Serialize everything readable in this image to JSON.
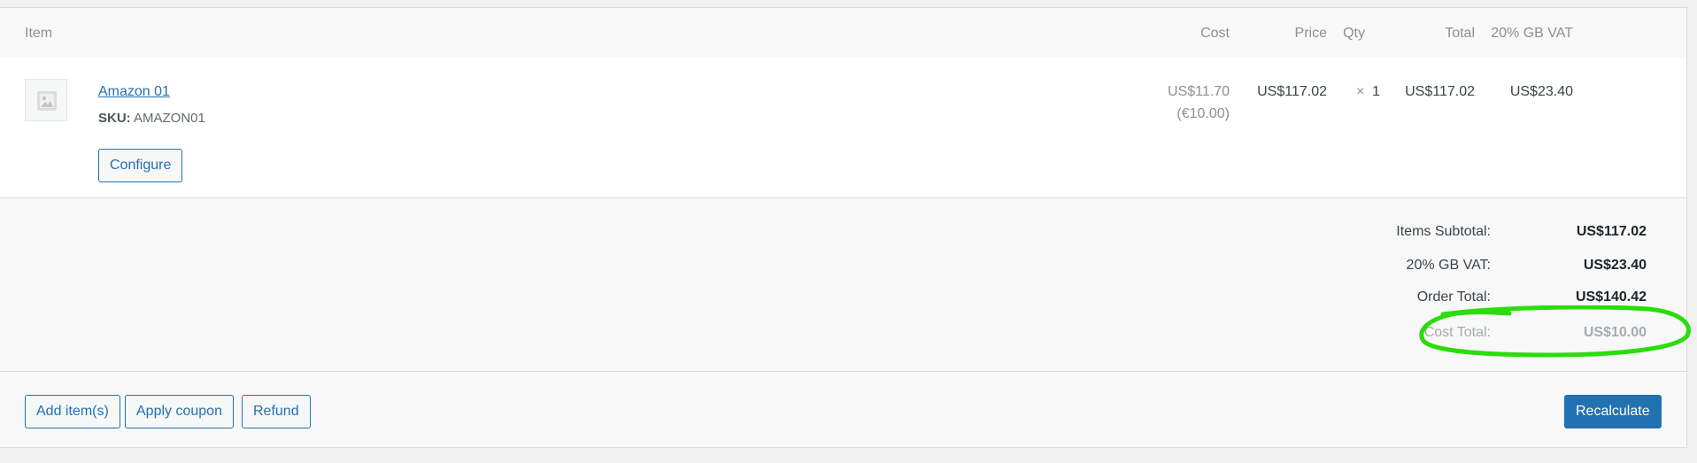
{
  "header": {
    "item": "Item",
    "cost": "Cost",
    "price": "Price",
    "qty": "Qty",
    "total": "Total",
    "tax": "20% GB VAT"
  },
  "line_item": {
    "name": "Amazon 01",
    "sku_label": "SKU:",
    "sku_value": "AMAZON01",
    "configure_label": "Configure",
    "cost": "US$11.70",
    "cost_original": "(€10.00)",
    "price": "US$117.02",
    "qty_symbol": "×",
    "qty": "1",
    "total": "US$117.02",
    "tax": "US$23.40",
    "thumbnail_icon": "image-placeholder-icon"
  },
  "totals": {
    "subtotal_label": "Items Subtotal:",
    "subtotal_value": "US$117.02",
    "tax_label": "20% GB VAT:",
    "tax_value": "US$23.40",
    "order_total_label": "Order Total:",
    "order_total_value": "US$140.42",
    "cost_total_label": "Cost Total:",
    "cost_total_value": "US$10.00"
  },
  "actions": {
    "add_items": "Add item(s)",
    "apply_coupon": "Apply coupon",
    "refund": "Refund",
    "recalculate": "Recalculate"
  },
  "colors": {
    "accent": "#2271b1",
    "annotation": "#2bdc0c"
  }
}
